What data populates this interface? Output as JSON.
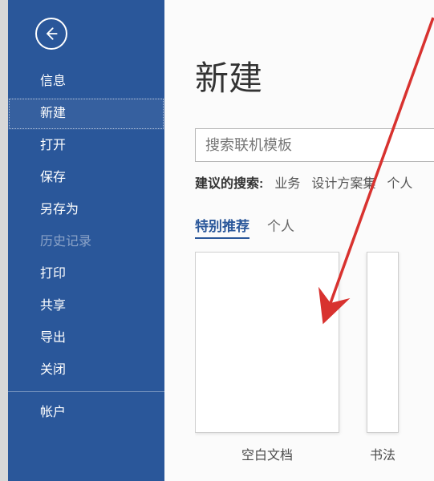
{
  "sidebar": {
    "items": [
      {
        "label": "信息"
      },
      {
        "label": "新建"
      },
      {
        "label": "打开"
      },
      {
        "label": "保存"
      },
      {
        "label": "另存为"
      },
      {
        "label": "历史记录"
      },
      {
        "label": "打印"
      },
      {
        "label": "共享"
      },
      {
        "label": "导出"
      },
      {
        "label": "关闭"
      },
      {
        "label": "帐户"
      }
    ]
  },
  "main": {
    "title": "新建",
    "search_placeholder": "搜索联机模板",
    "suggested_label": "建议的搜索:",
    "suggested": [
      "业务",
      "设计方案集",
      "个人"
    ],
    "tabs": [
      "特别推荐",
      "个人"
    ],
    "templates": [
      {
        "label": "空白文档"
      },
      {
        "label": "书法"
      }
    ]
  }
}
